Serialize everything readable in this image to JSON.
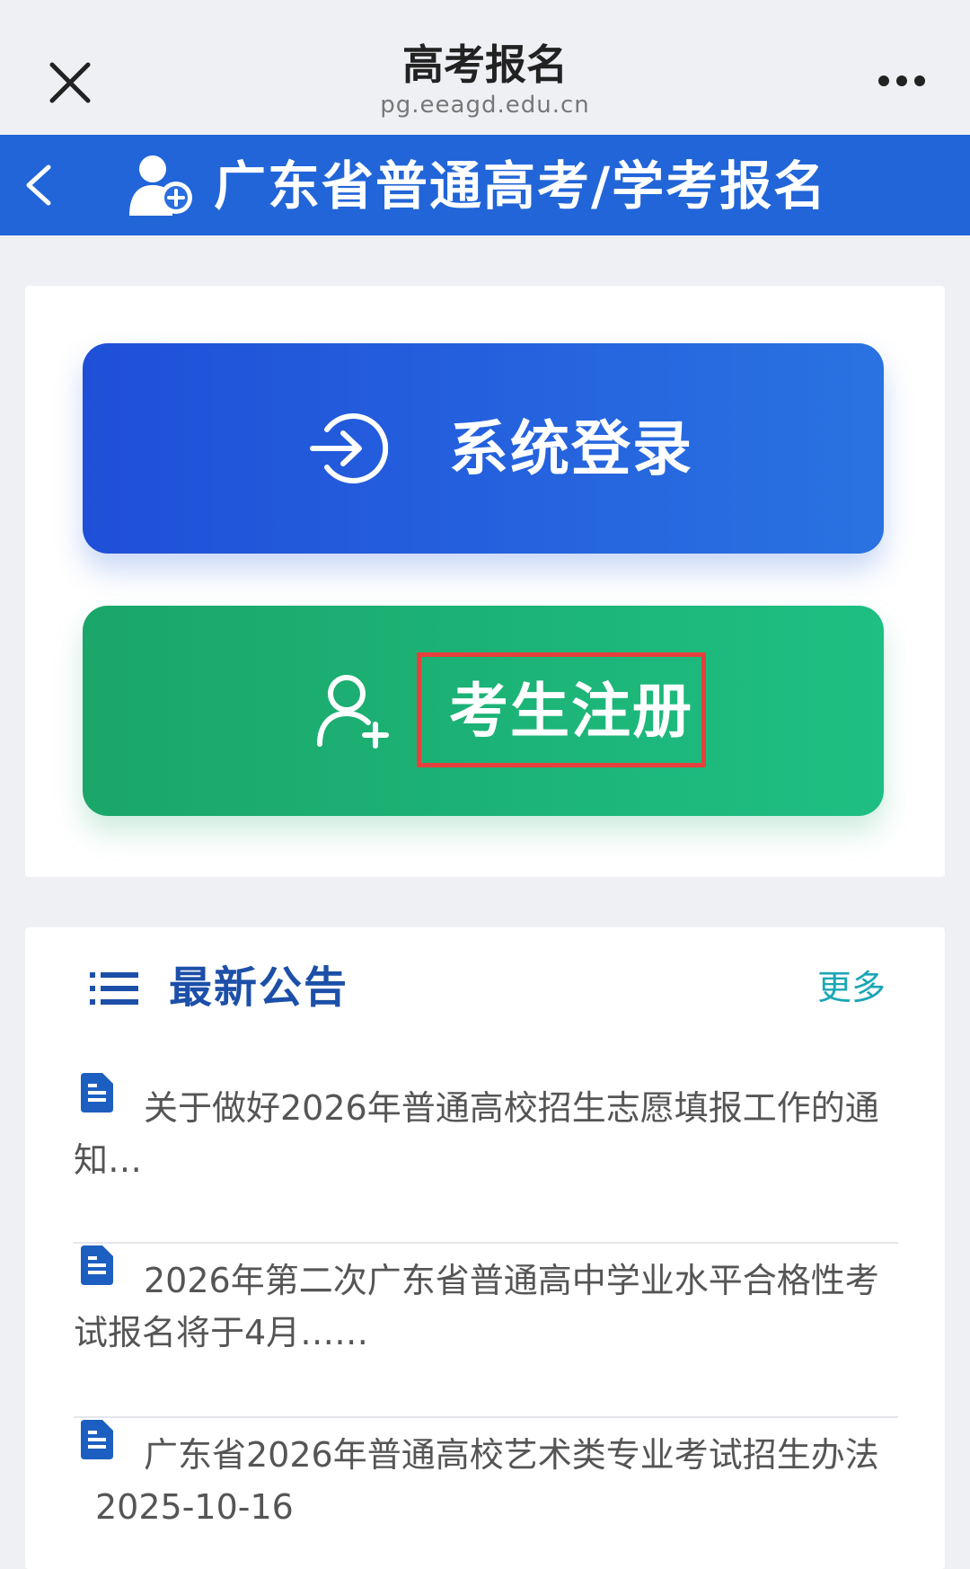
{
  "browser": {
    "title": "高考报名",
    "url": "pg.eeagd.edu.cn",
    "close_icon": "close-icon",
    "more_icon": "more-icon"
  },
  "header": {
    "title": "广东省普通高考/学考报名",
    "back_icon": "chevron-left-icon",
    "logo_icon": "user-add-icon",
    "background": "#2165d8"
  },
  "actions": {
    "login": {
      "label": "系统登录",
      "icon": "login-icon",
      "color": "#2563dc"
    },
    "register": {
      "label": "考生注册",
      "icon": "user-plus-icon",
      "color": "#1db177",
      "highlight_color": "#e6403e"
    }
  },
  "notices": {
    "title": "最新公告",
    "more_label": "更多",
    "list_icon": "list-icon",
    "items": [
      {
        "text": "关于做好2026年普通高校招生志愿填报工作的通知…",
        "icon": "document-icon"
      },
      {
        "text": "2026年第二次广东省普通高中学业水平合格性考试报名将于4月……",
        "icon": "document-icon"
      },
      {
        "text": "广东省2026年普通高校艺术类专业考试招生办法",
        "date": "2025-10-16",
        "icon": "document-icon"
      }
    ]
  }
}
